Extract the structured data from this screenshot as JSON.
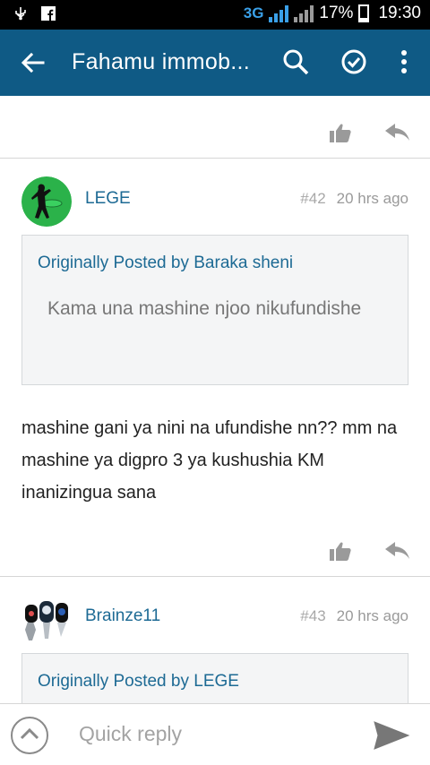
{
  "status_bar": {
    "network": "3G",
    "battery": "17%",
    "time": "19:30"
  },
  "app_bar": {
    "title": "Fahamu immob...",
    "icons": [
      "back-arrow-icon",
      "search-icon",
      "check-circle-icon",
      "more-vert-icon"
    ]
  },
  "posts": [
    {
      "username": "LEGE",
      "number": "#42",
      "time": "20 hrs ago",
      "quote": {
        "author": "Originally Posted by Baraka sheni",
        "text": "Kama una mashine njoo nikufundishe"
      },
      "body": "mashine gani ya nini na ufundishe nn?? mm na mashine ya digpro 3 ya kushushia KM inanizingua sana"
    },
    {
      "username": "Brainze11",
      "number": "#43",
      "time": "20 hrs ago",
      "quote": {
        "author": "Originally Posted by LEGE"
      }
    }
  ],
  "reply": {
    "placeholder": "Quick reply"
  },
  "colors": {
    "app_bar": "#0f5a85",
    "link": "#1d6a94",
    "quote_bg": "#f4f5f6"
  }
}
